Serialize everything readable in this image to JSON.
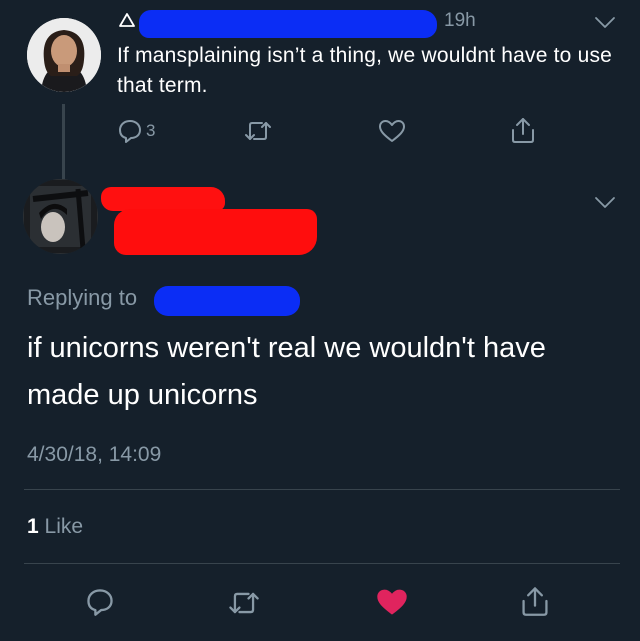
{
  "tweet": {
    "time": "19h",
    "text": "If mansplaining isn’t a thing, we wouldnt have to use that term.",
    "reply_count": "3",
    "icons": [
      "reply-icon",
      "retweet-icon",
      "like-icon",
      "share-icon",
      "chevron-down-icon",
      "triangle-icon"
    ]
  },
  "reply": {
    "replying_to_label": "Replying to",
    "text": "if unicorns weren't real we wouldn't have made up unicorns",
    "timestamp": "4/30/18, 14:09",
    "likes_count": "1",
    "likes_label": "Like",
    "liked": true,
    "icons": [
      "reply-icon",
      "retweet-icon",
      "heart-filled-icon",
      "share-icon",
      "chevron-down-icon"
    ]
  },
  "colors": {
    "background": "#15202b",
    "muted": "#8899a6",
    "like_active": "#e0245e",
    "redaction_blue": "#0b2df5",
    "redaction_red": "#ff1010"
  }
}
